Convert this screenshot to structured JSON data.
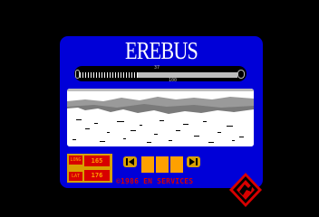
{
  "title": "EREBUS",
  "gauge": {
    "top_label": "37",
    "bottom_label": "100",
    "level": 0.37
  },
  "nav": {
    "long_label": "LONG",
    "lat_label": "LAT",
    "long_value": "165",
    "lat_value": "176"
  },
  "controls": {
    "left_arrow_icon": "left-arrow-icon",
    "right_arrow_icon": "right-arrow-icon",
    "slot_count": 3
  },
  "copyright": "©1986 EN SERVICES",
  "logo": {
    "icon": "dragon-diamond-logo"
  },
  "colors": {
    "frame": "#0000d8",
    "accent": "#d8a000",
    "red": "#d80000",
    "orange": "#ffa000",
    "grey": "#bdbdbd"
  }
}
